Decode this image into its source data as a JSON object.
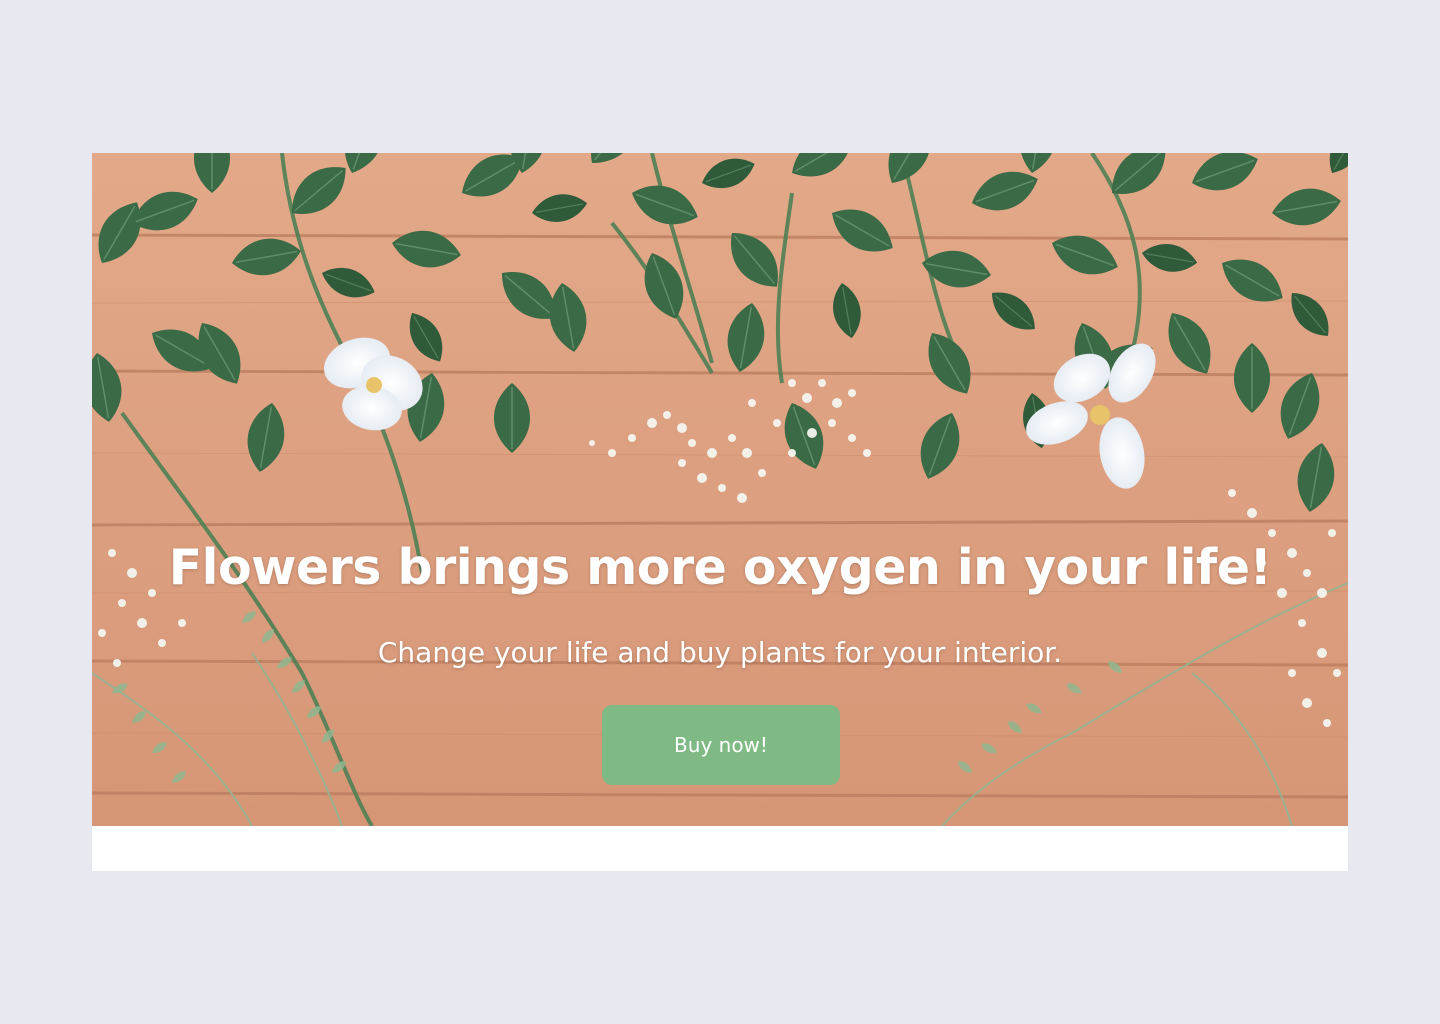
{
  "hero": {
    "headline": "Flowers brings more oxygen in your life!",
    "subheadline": "Change your life and buy plants for your interior.",
    "cta_label": "Buy now!"
  },
  "colors": {
    "page_background": "#e8e8f1",
    "card_background": "#ffffff",
    "cta_background": "#7fba84",
    "text": "#ffffff",
    "wood": "#d99b7a",
    "leaf": "#3a6b45"
  },
  "icons": {
    "hero_background": "flowers-on-wood-photo"
  }
}
